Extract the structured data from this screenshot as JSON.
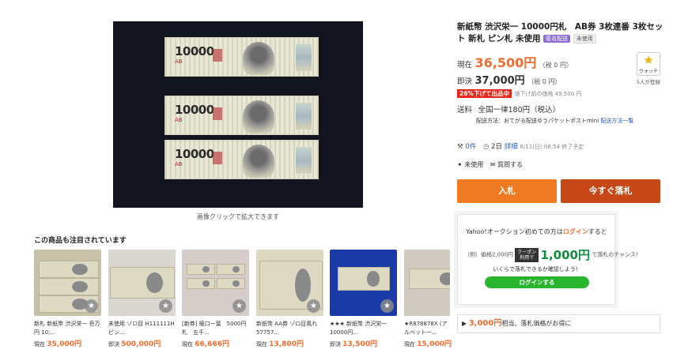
{
  "main_image": {
    "caption": "画像クリックで拡大できます"
  },
  "product": {
    "title": "新紙幣 渋沢栄一 10000円札　AB券 3枚連番 3枚セット 新札 ピン札 未使用",
    "badges": [
      "匿名配送",
      "未使用"
    ]
  },
  "price": {
    "current_label": "現在",
    "current_value": "36,500円",
    "current_tax": "（税 0 円）",
    "buy_label": "即決",
    "buy_value": "37,000円",
    "buy_tax": "（税 0 円）",
    "discount_badge": "26%下げて出品中",
    "before_price": "値下げ前の価格 49,500 円"
  },
  "shipping": {
    "label": "送料",
    "value": "全国一律180円（税込）",
    "method": "配送方法：おてがる配送ゆうパケットポストmini",
    "method_link": "配送方法一覧"
  },
  "stats": {
    "bids": "0件",
    "time_left": "2日",
    "detail_link": "詳細",
    "end_time": "8/11(日) 08:54 終了予定",
    "condition": "未使用",
    "question_link": "質問する"
  },
  "watch": {
    "label": "ウォッチ",
    "count": "5人が登録"
  },
  "buttons": {
    "bid": "入札",
    "buy_now": "今すぐ落札"
  },
  "login_promo": {
    "line1_prefix": "Yahoo!オークション初めての方は",
    "line1_link": "ログイン",
    "line1_suffix": "すると",
    "example": "（例）価格2,000円",
    "coupon_top": "クーポン",
    "coupon_bottom": "利用で",
    "amount": "1,000円",
    "chance": "で落札のチャンス!",
    "line3": "いくらで落札できるか確認しよう！",
    "button": "ログインする"
  },
  "promo_bar": {
    "amount": "3,000円",
    "text": "相当、落札価格がお得に"
  },
  "related": {
    "title": "この商品も注目されています",
    "items": [
      {
        "title": "新札 新紙幣 渋沢栄一 壱万円 10,...",
        "price_label": "現在",
        "price": "35,000円"
      },
      {
        "title": "未使用 ゾロ目 H111111H ピン...",
        "price_label": "即決",
        "price": "500,000円"
      },
      {
        "title": "[新券] 極口一葉　5000円札　五千...",
        "price_label": "現在",
        "price": "66,666円"
      },
      {
        "title": "新紙幣 AA券 ゾロ目風れ 57757...",
        "price_label": "現在",
        "price": "13,800円"
      },
      {
        "title": "★★★ 新紙幣 渋沢栄一 10000円...",
        "price_label": "即決",
        "price": "13,500円"
      },
      {
        "title": "★R878878X (アルベット一...",
        "price_label": "現在",
        "price": "15,000円"
      }
    ]
  },
  "colors": {
    "accent": "#f26c2e",
    "bid": "#ef7a22",
    "buy": "#c74716",
    "login": "#2ab52e"
  }
}
